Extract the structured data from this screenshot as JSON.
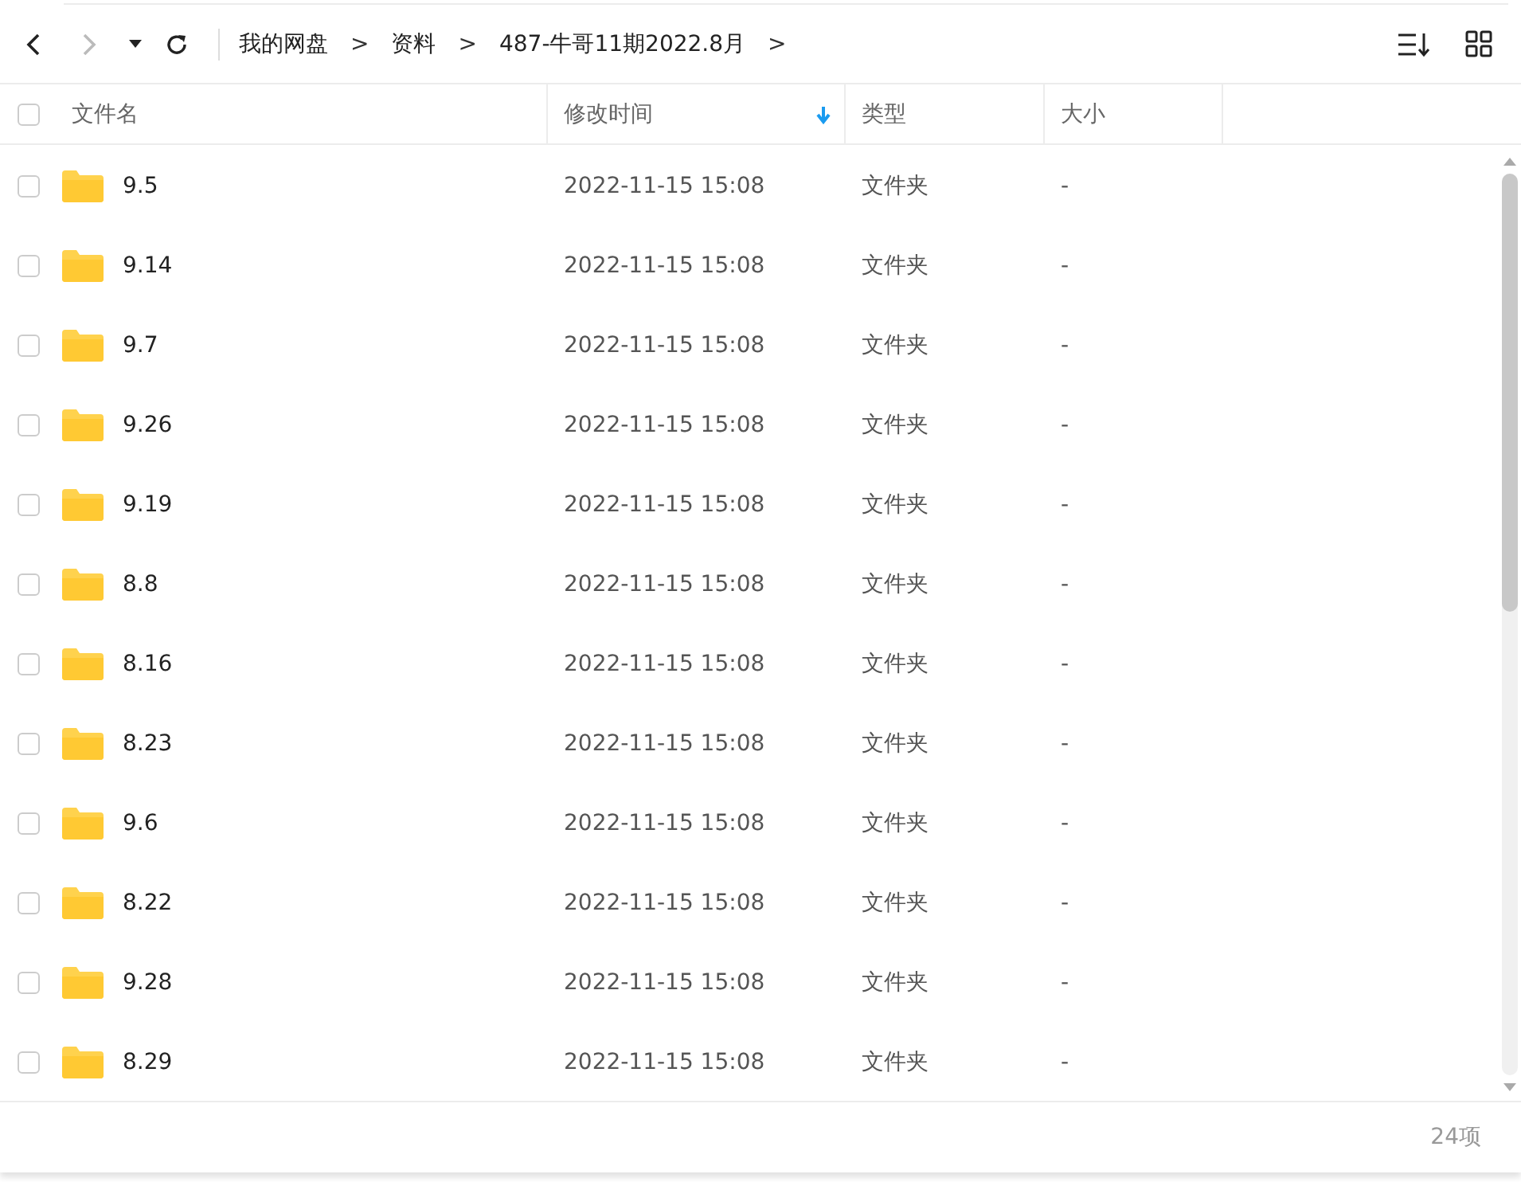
{
  "toolbar": {
    "back_disabled": false,
    "forward_disabled": true
  },
  "breadcrumb": [
    {
      "label": "我的网盘",
      "separator": ">"
    },
    {
      "label": "资料",
      "separator": ">"
    },
    {
      "label": "487-牛哥11期2022.8月",
      "separator": ">"
    }
  ],
  "table": {
    "all_checked": false,
    "columns": [
      {
        "label": "文件名",
        "sorted": false
      },
      {
        "label": "修改时间",
        "sorted": true
      },
      {
        "label": "类型",
        "sorted": false
      },
      {
        "label": "大小",
        "sorted": false
      }
    ],
    "rows": [
      {
        "name": "9.5",
        "modified": "2022-11-15 15:08",
        "type": "文件夹",
        "size": "-",
        "checked": false
      },
      {
        "name": "9.14",
        "modified": "2022-11-15 15:08",
        "type": "文件夹",
        "size": "-",
        "checked": false
      },
      {
        "name": "9.7",
        "modified": "2022-11-15 15:08",
        "type": "文件夹",
        "size": "-",
        "checked": false
      },
      {
        "name": "9.26",
        "modified": "2022-11-15 15:08",
        "type": "文件夹",
        "size": "-",
        "checked": false
      },
      {
        "name": "9.19",
        "modified": "2022-11-15 15:08",
        "type": "文件夹",
        "size": "-",
        "checked": false
      },
      {
        "name": "8.8",
        "modified": "2022-11-15 15:08",
        "type": "文件夹",
        "size": "-",
        "checked": false
      },
      {
        "name": "8.16",
        "modified": "2022-11-15 15:08",
        "type": "文件夹",
        "size": "-",
        "checked": false
      },
      {
        "name": "8.23",
        "modified": "2022-11-15 15:08",
        "type": "文件夹",
        "size": "-",
        "checked": false
      },
      {
        "name": "9.6",
        "modified": "2022-11-15 15:08",
        "type": "文件夹",
        "size": "-",
        "checked": false
      },
      {
        "name": "8.22",
        "modified": "2022-11-15 15:08",
        "type": "文件夹",
        "size": "-",
        "checked": false
      },
      {
        "name": "9.28",
        "modified": "2022-11-15 15:08",
        "type": "文件夹",
        "size": "-",
        "checked": false
      },
      {
        "name": "8.29",
        "modified": "2022-11-15 15:08",
        "type": "文件夹",
        "size": "-",
        "checked": false
      }
    ]
  },
  "status_bar": {
    "count": "24项"
  }
}
